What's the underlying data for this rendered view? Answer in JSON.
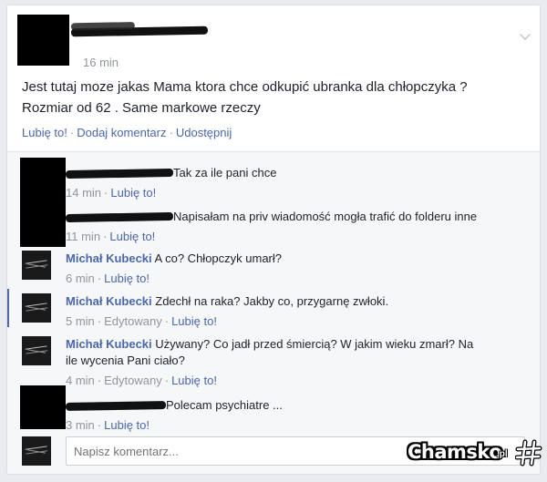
{
  "post": {
    "time": "16 min",
    "text_line1": "Jest tutaj moze jakas Mama ktora chce odkupić ubranka dla chłopczyka ?",
    "text_line2": "Rozmiar od 62 . Same markowe rzeczy",
    "actions": {
      "like": "Lubię to!",
      "comment": "Dodaj komentarz",
      "share": "Udostępnij"
    }
  },
  "comments": [
    {
      "author": "",
      "text": "Tak za ile pani chce",
      "time": "14 min",
      "like": "Lubię to!"
    },
    {
      "author": "",
      "text": "Napisałam na priv wiadomość mogła trafić do folderu inne",
      "time": "11 min",
      "like": "Lubię to!"
    },
    {
      "author": "Michał Kubecki",
      "text": "A co? Chłopczyk umarł?",
      "time": "6 min",
      "like": "Lubię to!"
    },
    {
      "author": "Michał Kubecki",
      "text": "Zdechł na raka? Jakby co, przygarnę zwłoki.",
      "time": "5 min",
      "edited": "Edytowany",
      "like": "Lubię to!"
    },
    {
      "author": "Michał Kubecki",
      "text_line1": "Używany? Co jadł przed śmiercią? W jakim wieku zmarł? Na",
      "text_line2": "ile wycenia Pani ciało?",
      "time": "4 min",
      "edited": "Edytowany",
      "like": "Lubię to!"
    },
    {
      "author": "",
      "text": "Polecam psychiatre ...",
      "time": "3 min",
      "like": "Lubię to!"
    }
  ],
  "composer": {
    "placeholder": "Napisz komentarz..."
  },
  "watermark": {
    "name": "Chamsko",
    "tld": ".pl"
  },
  "icons": {
    "menu": "chevron-down-icon",
    "watermark_mark": "hash-icon"
  },
  "colors": {
    "link": "#4b67a8",
    "meta": "#90949c",
    "text": "#1d2129",
    "background": "#e9ebee"
  }
}
